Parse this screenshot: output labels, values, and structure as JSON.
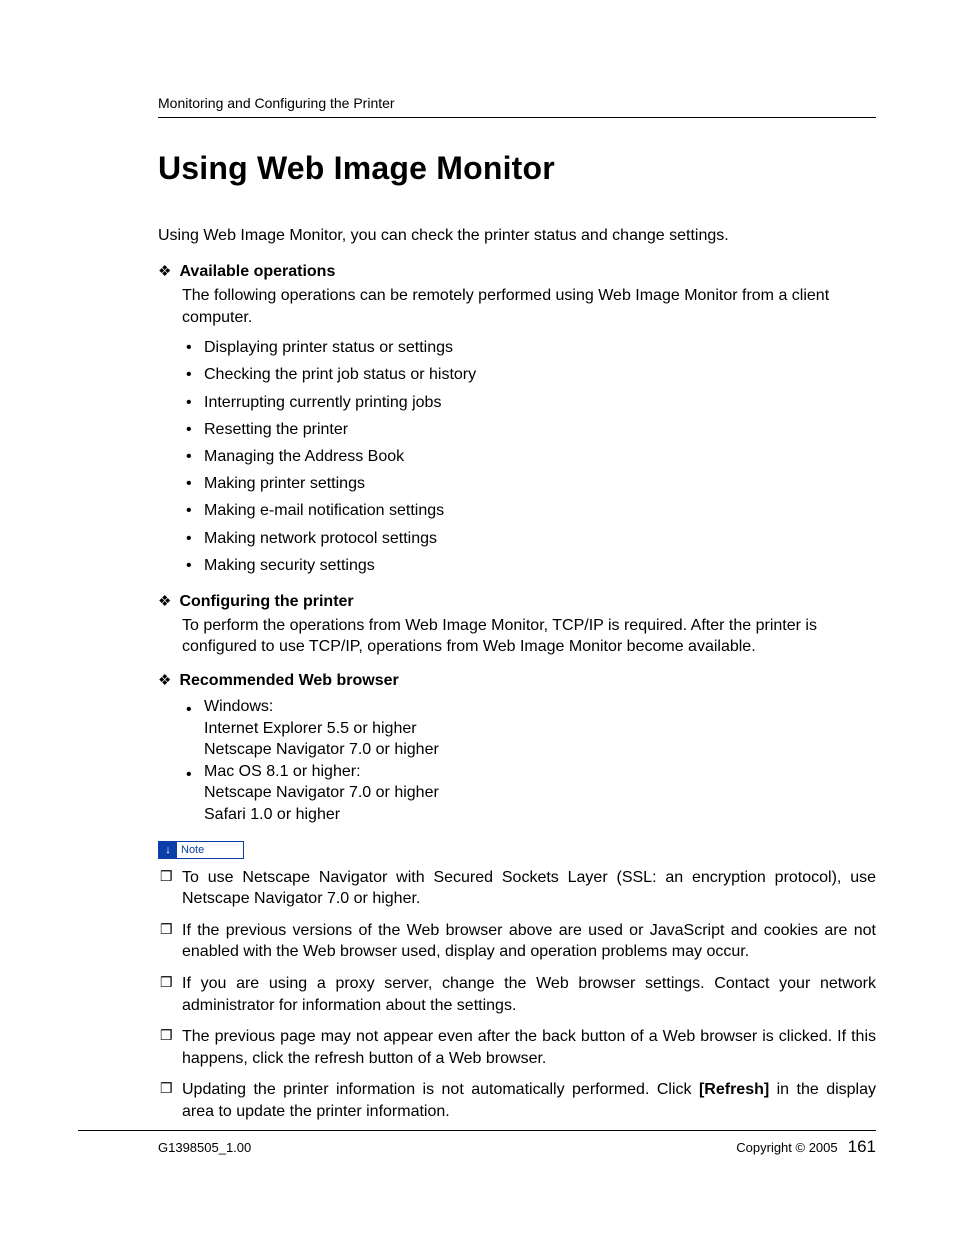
{
  "header": {
    "breadcrumb": "Monitoring and Configuring the Printer"
  },
  "title": "Using Web Image Monitor",
  "intro": "Using Web Image Monitor, you can check the printer status and change settings.",
  "sections": {
    "available": {
      "heading": "Available operations",
      "body": "The following operations can be remotely performed using Web Image Monitor from a client computer.",
      "items": [
        "Displaying printer status or settings",
        "Checking the print job status or history",
        "Interrupting currently printing jobs",
        "Resetting the printer",
        "Managing the Address Book",
        "Making printer settings",
        "Making e-mail notification settings",
        "Making network protocol settings",
        "Making security settings"
      ]
    },
    "configuring": {
      "heading": "Configuring the printer",
      "body": "To perform the operations from Web Image Monitor, TCP/IP is required. After the printer is configured to use TCP/IP, operations from Web Image Monitor become available."
    },
    "browser": {
      "heading": "Recommended Web browser",
      "items": [
        {
          "head": "Windows:",
          "lines": [
            "Internet Explorer 5.5 or higher",
            "Netscape Navigator 7.0 or higher"
          ]
        },
        {
          "head": "Mac OS 8.1 or higher:",
          "lines": [
            "Netscape Navigator 7.0 or higher",
            "Safari 1.0 or higher"
          ]
        }
      ]
    }
  },
  "note_label": "Note",
  "notes": [
    {
      "text": "To use Netscape Navigator with Secured Sockets Layer (SSL: an encryption protocol), use Netscape Navigator 7.0 or higher."
    },
    {
      "text": "If the previous versions of the Web browser above are used or JavaScript and cookies are not enabled with the Web browser used, display and operation problems may occur."
    },
    {
      "text": "If you are using a proxy server, change the Web browser settings. Contact your network administrator for information about the settings."
    },
    {
      "text": "The previous page may not appear even after the back button of a Web browser is clicked. If this happens, click the refresh button of a Web browser."
    },
    {
      "pre": "Updating the printer information is not automatically performed. Click ",
      "bold": "[Refresh]",
      "post": " in the display area to update the printer information."
    }
  ],
  "footer": {
    "doc_id": "G1398505_1.00",
    "copyright": "Copyright © 2005",
    "page": "161"
  }
}
